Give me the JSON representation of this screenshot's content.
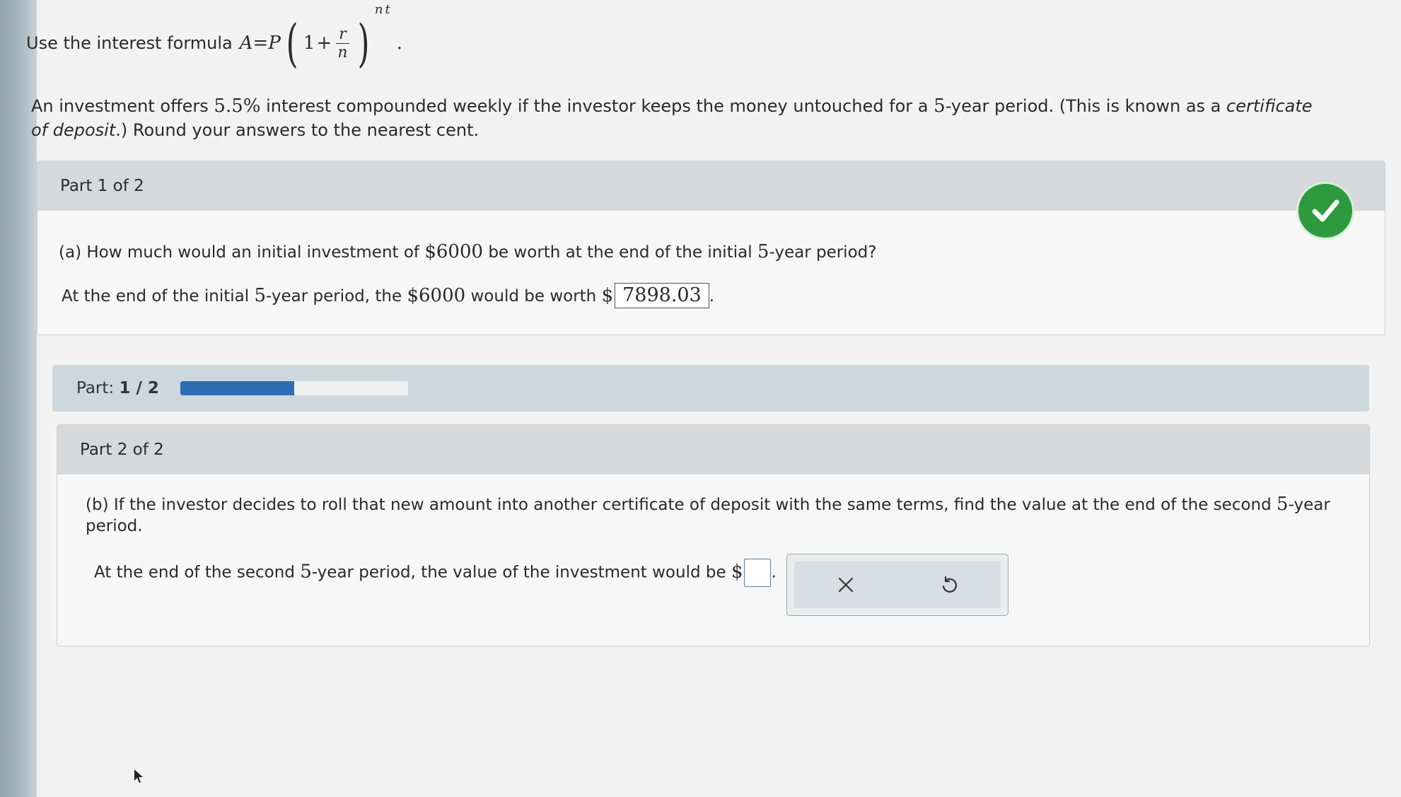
{
  "intro": {
    "text": "Use the interest formula",
    "formula": {
      "lhs": "A",
      "eq": "=",
      "p": "P",
      "one": "1",
      "plus": "+",
      "num": "r",
      "den": "n",
      "exp": "nt",
      "end": "."
    }
  },
  "problem": {
    "t1": "An investment offers ",
    "rate": "5.5%",
    "t2": " interest compounded weekly if the investor keeps the money untouched for a ",
    "years": "5",
    "t3": "-year period. (This is known as a ",
    "term": "certificate of deposit",
    "t4": ".) Round your answers to the nearest cent."
  },
  "part1": {
    "header": "Part 1 of 2",
    "question": {
      "prefix": "(a) How much would an initial investment of ",
      "amount": "$6000",
      "middle": " be worth at the end of the initial ",
      "years": "5",
      "suffix": "-year period?"
    },
    "answer": {
      "prefix": "At the end of the initial ",
      "years": "5",
      "middle": "-year period, the ",
      "amount": "$6000",
      "suffix": " would be worth ",
      "dollar": "$",
      "value": "7898.03",
      "end": "."
    },
    "status_icon": "checkmark-icon"
  },
  "progress": {
    "label": "Part:",
    "current": "1",
    "sep": " / ",
    "total": "2",
    "fraction": 0.5,
    "fill_color": "#2c6eb5"
  },
  "part2": {
    "header": "Part 2 of 2",
    "question": {
      "prefix": "(b) If the investor decides to roll that new amount into another certificate of deposit with the same terms, find the value at the end of the second ",
      "years": "5",
      "suffix": "-year period."
    },
    "answer": {
      "prefix": "At the end of the second ",
      "years": "5",
      "suffix": "-year period, the value of the investment would be ",
      "dollar": "$",
      "value": "",
      "end": "."
    }
  },
  "toolbar": {
    "clear_icon": "x-icon",
    "undo_icon": "undo-icon"
  },
  "colors": {
    "check_green": "#2e9a3e",
    "header_gray": "#d6d9db",
    "progress_bg": "#ccd7de"
  }
}
